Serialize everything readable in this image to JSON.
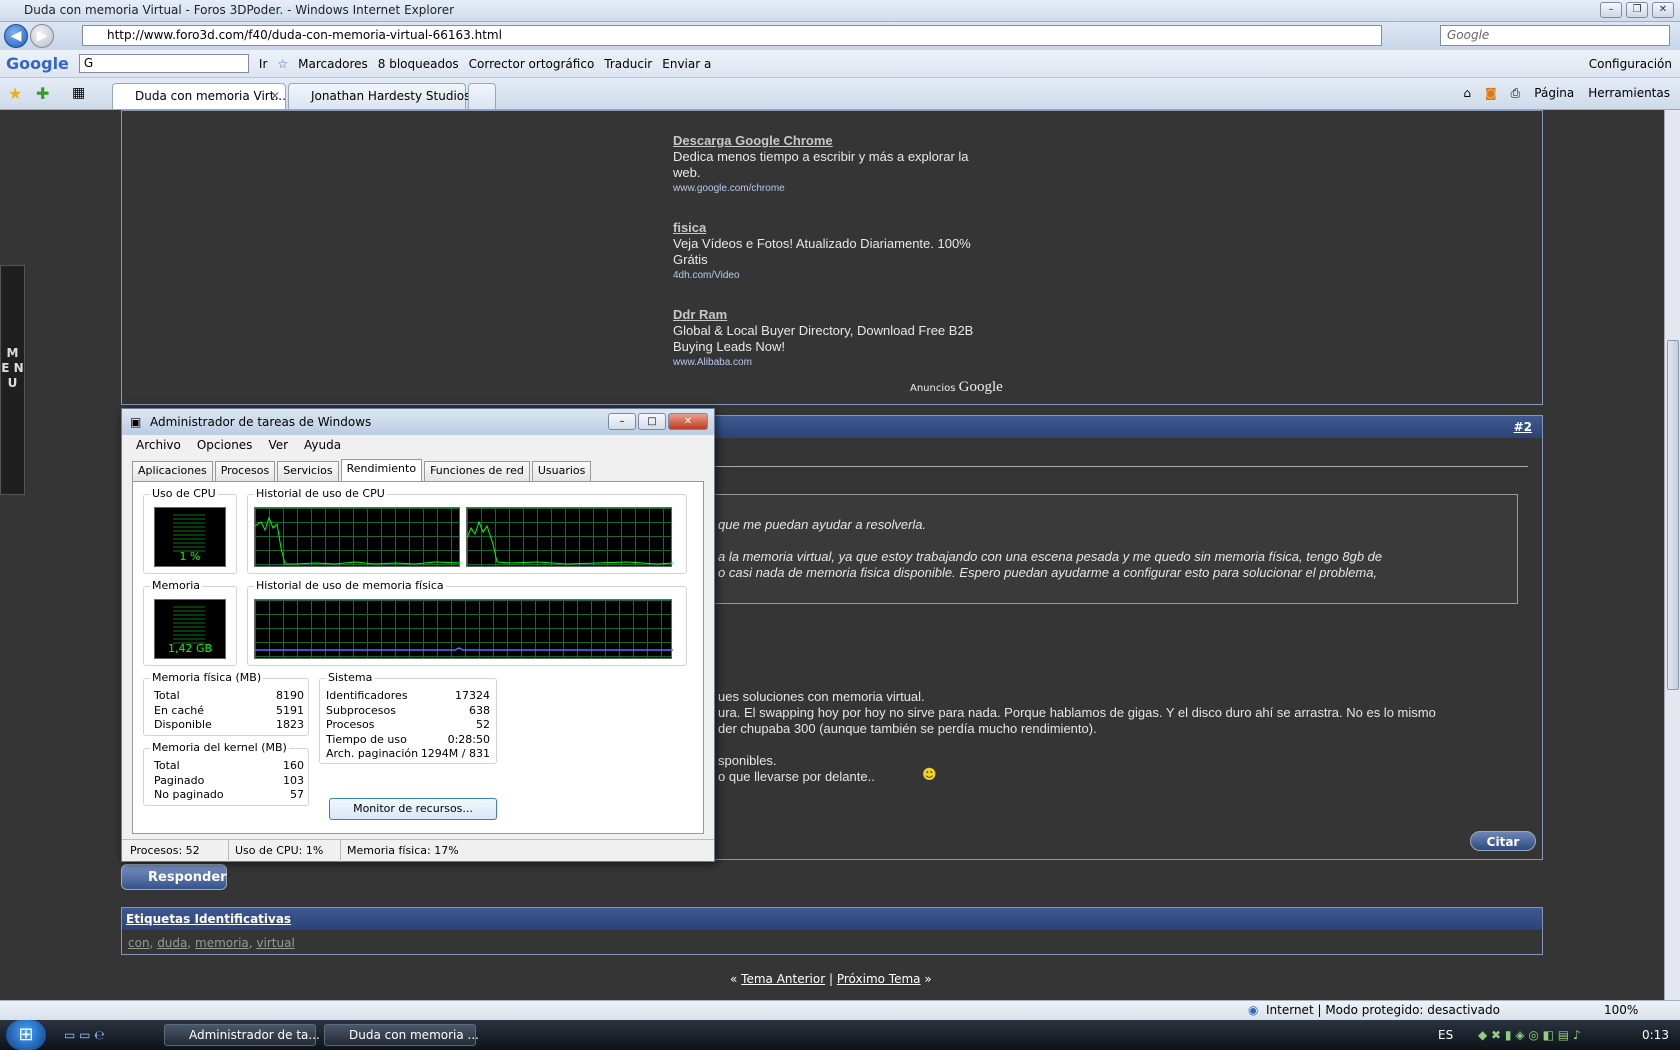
{
  "browser": {
    "title": "Duda con memoria Virtual - Foros 3DPoder. - Windows Internet Explorer",
    "url": "http://www.foro3d.com/f40/duda-con-memoria-virtual-66163.html",
    "search_placeholder": "Google",
    "google_bar": {
      "logo": "Google",
      "box_value": "G",
      "go": "Ir",
      "bookmarks": "Marcadores",
      "blocked": "8 bloqueados",
      "spell": "Corrector ortográfico",
      "translate": "Traducir",
      "send": "Enviar a",
      "settings": "Configuración"
    },
    "tabs": [
      {
        "label": "Duda con memoria Virt..."
      },
      {
        "label": "Jonathan Hardesty Studios"
      }
    ],
    "tools": {
      "page": "Página",
      "tools": "Herramientas"
    },
    "status": {
      "zone": "Internet | Modo protegido: desactivado",
      "zoom": "100%"
    }
  },
  "site": {
    "side_menu": "M E N U",
    "ads": [
      {
        "title": "Descarga Google Chrome",
        "text": "Dedica menos tiempo a escribir y más a explorar la web.",
        "url": "www.google.com/chrome"
      },
      {
        "title": "fisica",
        "text": "Veja Vídeos e Fotos! Atualizado Diariamente. 100% Grátis",
        "url": "4dh.com/Video"
      },
      {
        "title": "Ddr Ram",
        "text": "Global & Local Buyer Directory, Download Free B2B Buying Leads Now!",
        "url": "www.Alibaba.com"
      }
    ],
    "ads_label": "Anuncios",
    "ads_brand": "Google",
    "post": {
      "number": "#2",
      "quote_lines": [
        "que me puedan ayudar a resolverla.",
        "a la memoria virtual, ya que estoy trabajando con una escena pesada y me quedo sin memoria física, tengo 8gb de",
        "o casi nada de memoria fisica disponible. Espero puedan ayudarme a configurar esto para solucionar el problema,"
      ],
      "body_lines": [
        "ues soluciones con memoria virtual.",
        "ura. El swapping hoy por hoy no sirve para nada. Porque hablamos de gigas. Y el disco duro ahí se arrastra. No es lo mismo",
        "der chupaba 300 (aunque también se perdía mucho rendimiento).",
        "sponibles.",
        "o que llevarse por delante.."
      ],
      "quote_button": "Citar"
    },
    "reply_button": "Responder",
    "tags_title": "Etiquetas Identificativas",
    "tags": [
      "con",
      "duda",
      "memoria",
      "virtual"
    ],
    "nav": {
      "prev": "Tema Anterior",
      "sep": "|",
      "next": "Próximo Tema",
      "left": "«",
      "right": "»"
    }
  },
  "taskmgr": {
    "title": "Administrador de tareas de Windows",
    "menu": [
      "Archivo",
      "Opciones",
      "Ver",
      "Ayuda"
    ],
    "tabs": [
      "Aplicaciones",
      "Procesos",
      "Servicios",
      "Rendimiento",
      "Funciones de red",
      "Usuarios"
    ],
    "cpu_label": "Uso de CPU",
    "cpu_value": "1 %",
    "cpu_history_label": "Historial de uso de CPU",
    "mem_label": "Memoria",
    "mem_value": "1,42 GB",
    "mem_history_label": "Historial de uso de memoria física",
    "physical": {
      "label": "Memoria física (MB)",
      "rows": [
        [
          "Total",
          "8190"
        ],
        [
          "En caché",
          "5191"
        ],
        [
          "Disponible",
          "1823"
        ]
      ]
    },
    "kernel": {
      "label": "Memoria del kernel (MB)",
      "rows": [
        [
          "Total",
          "160"
        ],
        [
          "Paginado",
          "103"
        ],
        [
          "No paginado",
          "57"
        ]
      ]
    },
    "system": {
      "label": "Sistema",
      "rows": [
        [
          "Identificadores",
          "17324"
        ],
        [
          "Subprocesos",
          "638"
        ],
        [
          "Procesos",
          "52"
        ],
        [
          "Tiempo de uso",
          "0:28:50"
        ],
        [
          "Arch. paginación",
          "1294M / 831"
        ]
      ]
    },
    "resource_button": "Monitor de recursos...",
    "status": {
      "procs": "Procesos: 52",
      "cpu": "Uso de CPU: 1%",
      "mem": "Memoria física: 17%"
    }
  },
  "taskbar": {
    "items": [
      "Administrador de ta...",
      "Duda con memoria ..."
    ],
    "lang": "ES",
    "clock": "0:13"
  }
}
